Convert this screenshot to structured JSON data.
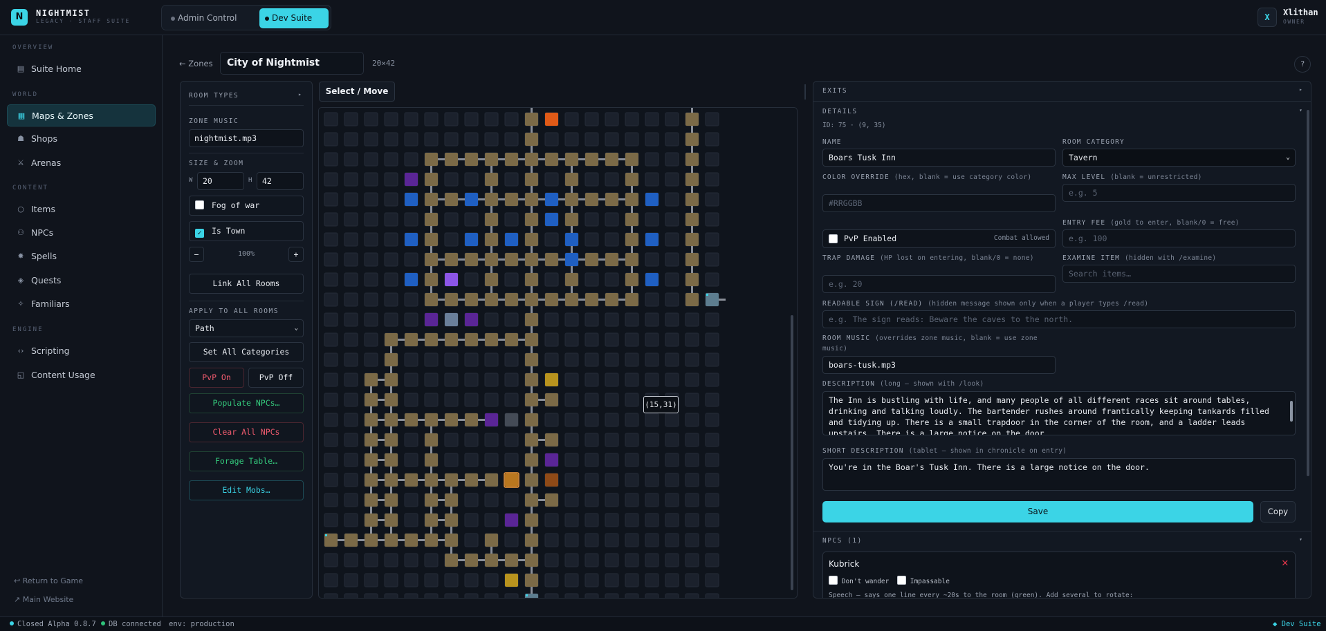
{
  "brand": {
    "name": "NIGHTMIST",
    "subtitle": "LEGACY · STAFF SUITE",
    "logo_letter": "N"
  },
  "suite_switch": {
    "admin_label": "Admin Control",
    "dev_label": "Dev Suite"
  },
  "user": {
    "initial": "X",
    "name": "Xlithan",
    "role": "OWNER"
  },
  "sidebar": {
    "sections": [
      {
        "heading": "OVERVIEW",
        "items": [
          {
            "label": "Suite Home",
            "icon": "grid-icon"
          }
        ]
      },
      {
        "heading": "WORLD",
        "items": [
          {
            "label": "Maps & Zones",
            "icon": "map-icon",
            "active": true
          },
          {
            "label": "Shops",
            "icon": "shop-icon"
          },
          {
            "label": "Arenas",
            "icon": "arena-icon"
          }
        ]
      },
      {
        "heading": "CONTENT",
        "items": [
          {
            "label": "Items",
            "icon": "item-icon"
          },
          {
            "label": "NPCs",
            "icon": "npc-icon"
          },
          {
            "label": "Spells",
            "icon": "spell-icon"
          },
          {
            "label": "Quests",
            "icon": "quest-icon"
          },
          {
            "label": "Familiars",
            "icon": "familiar-icon"
          }
        ]
      },
      {
        "heading": "ENGINE",
        "items": [
          {
            "label": "Scripting",
            "icon": "code-icon"
          },
          {
            "label": "Content Usage",
            "icon": "usage-icon"
          }
        ]
      }
    ],
    "footer": {
      "return_label": "Return to Game",
      "website_label": "Main Website"
    }
  },
  "zone": {
    "back_label": "← Zones",
    "name": "City of Nightmist",
    "dims": "20×42",
    "help": "?"
  },
  "left_panel": {
    "room_types_label": "ROOM TYPES",
    "zone_music_label": "ZONE MUSIC",
    "zone_music_value": "nightmist.mp3",
    "size_zoom_label": "SIZE & ZOOM",
    "w_label": "W",
    "w_value": "20",
    "h_label": "H",
    "h_value": "42",
    "fog_label": "Fog of war",
    "fog_checked": false,
    "town_label": "Is Town",
    "town_checked": true,
    "zoom_minus": "−",
    "zoom_value": "100%",
    "zoom_plus": "+",
    "link_all_label": "Link All Rooms",
    "apply_label": "APPLY TO ALL ROOMS",
    "apply_select": "Path",
    "set_all_label": "Set All Categories",
    "pvp_on_label": "PvP On",
    "pvp_off_label": "PvP Off",
    "populate_label": "Populate NPCs…",
    "clear_label": "Clear All NPCs",
    "forage_label": "Forage Table…",
    "edit_mobs_label": "Edit Mobs…"
  },
  "map": {
    "tool_label": "Select / Move",
    "hover_coord": "(15,31)"
  },
  "colors": {
    "accent": "#3bd4e6",
    "path": "#7b6a47",
    "blue": "#1f5fc2",
    "purple": "#5a2596",
    "orange": "#e05a17",
    "gold": "#b8931e",
    "danger": "#e0364a",
    "success": "#2fc37a"
  },
  "right_panel": {
    "exits_label": "EXITS",
    "details_label": "DETAILS",
    "room_id_line": "ID: 75  ·  (9, 35)",
    "name_label": "NAME",
    "name_value": "Boars Tusk Inn",
    "category_label": "ROOM CATEGORY",
    "category_value": "Tavern",
    "color_label": "COLOR OVERRIDE",
    "color_hint": "(hex, blank = use category color)",
    "color_placeholder": "#RRGGBB",
    "max_level_label": "MAX LEVEL",
    "max_level_hint": "(blank = unrestricted)",
    "max_level_placeholder": "e.g. 5",
    "entry_fee_label": "ENTRY FEE",
    "entry_fee_hint": "(gold to enter, blank/0 = free)",
    "entry_fee_placeholder": "e.g. 100",
    "pvp_label": "PvP Enabled",
    "pvp_hint": "Combat allowed",
    "trap_label": "TRAP DAMAGE",
    "trap_hint": "(HP lost on entering, blank/0 = none)",
    "trap_placeholder": "e.g. 20",
    "examine_label": "EXAMINE ITEM",
    "examine_hint": "(hidden with /examine)",
    "examine_placeholder": "Search items…",
    "sign_label": "READABLE SIGN (/READ)",
    "sign_hint": "(hidden message shown only when a player types /read)",
    "sign_placeholder": "e.g. The sign reads: Beware the caves to the north.",
    "room_music_label": "ROOM MUSIC",
    "room_music_hint": "(overrides zone music, blank = use zone music)",
    "room_music_value": "boars-tusk.mp3",
    "description_label": "DESCRIPTION",
    "description_hint": "(long — shown with /look)",
    "description_value": "The Inn is bustling with life, and many people of all different races sit around tables, drinking and talking loudly. The bartender rushes around frantically keeping tankards filled and tidying up. There is a small trapdoor in the corner of the room, and a ladder leads upstairs. There is a large notice on the door.",
    "short_label": "SHORT DESCRIPTION",
    "short_hint": "(tablet — shown in chronicle on entry)",
    "short_value": "You're in the Boar's Tusk Inn. There is a large notice on the door.",
    "save_label": "Save",
    "copy_label": "Copy",
    "npcs_label": "NPCS (1)",
    "npc_name": "Kubrick",
    "dont_wander_label": "Don't wander",
    "impassable_label": "Impassable",
    "speech_text": "Speech — says one line every ~20s to the room (green). Add several to rotate:"
  },
  "status": {
    "version": "Closed Alpha 0.8.7",
    "db": "DB connected",
    "env": "env: production",
    "suite": "◆ Dev Suite"
  }
}
